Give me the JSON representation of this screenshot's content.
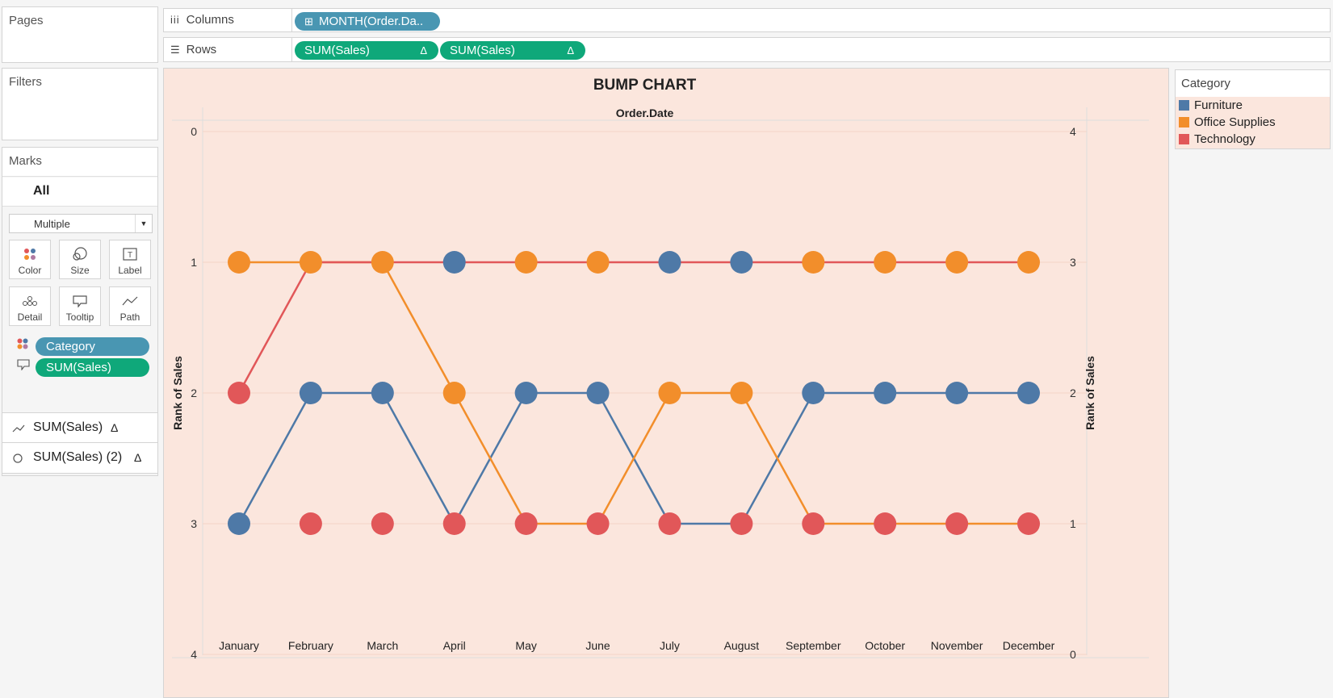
{
  "shelves": {
    "pages_label": "Pages",
    "filters_label": "Filters",
    "columns_label": "Columns",
    "rows_label": "Rows",
    "columns_pill": "MONTH(Order.Da..",
    "rows_pills": [
      "SUM(Sales)",
      "SUM(Sales)"
    ],
    "delta_symbol": "Δ"
  },
  "marks": {
    "title": "Marks",
    "all_label": "All",
    "mark_type": "Multiple",
    "buttons": [
      {
        "label": "Color",
        "icon": "color-icon"
      },
      {
        "label": "Size",
        "icon": "size-icon"
      },
      {
        "label": "Label",
        "icon": "label-icon"
      },
      {
        "label": "Detail",
        "icon": "detail-icon"
      },
      {
        "label": "Tooltip",
        "icon": "tooltip-icon"
      },
      {
        "label": "Path",
        "icon": "path-icon"
      }
    ],
    "fields": [
      {
        "label": "Category",
        "icon": "color-icon",
        "color": "#4996b2"
      },
      {
        "label": "SUM(Sales)",
        "icon": "tooltip-icon",
        "color": "#0fa87a"
      }
    ],
    "cards": [
      {
        "label": "SUM(Sales)",
        "delta": "Δ",
        "icon": "line-icon"
      },
      {
        "label": "SUM(Sales) (2)",
        "delta": "Δ",
        "icon": "circle-icon"
      }
    ]
  },
  "legend": {
    "title": "Category",
    "items": [
      {
        "label": "Furniture",
        "color": "#4e79a7"
      },
      {
        "label": "Office Supplies",
        "color": "#f28e2b"
      },
      {
        "label": "Technology",
        "color": "#e15759"
      }
    ]
  },
  "chart_data": {
    "type": "line",
    "title": "BUMP CHART",
    "column_header": "Order.Date",
    "ylabel": "Rank of Sales",
    "y2label": "Rank of Sales",
    "ylim": [
      4,
      0
    ],
    "y_ticks": [
      "0",
      "1",
      "2",
      "3",
      "4"
    ],
    "y2_ticks": [
      "4",
      "3",
      "2",
      "1",
      "0"
    ],
    "background": "#fbe6dd",
    "categories": [
      "January",
      "February",
      "March",
      "April",
      "May",
      "June",
      "July",
      "August",
      "September",
      "October",
      "November",
      "December"
    ],
    "series": [
      {
        "name": "Furniture",
        "color": "#4e79a7",
        "values": [
          3,
          2,
          2,
          3,
          2,
          2,
          3,
          3,
          2,
          2,
          2,
          2
        ]
      },
      {
        "name": "Office Supplies",
        "color": "#f28e2b",
        "values": [
          1,
          1,
          1,
          2,
          3,
          3,
          2,
          2,
          3,
          3,
          3,
          3
        ]
      },
      {
        "name": "Technology",
        "color": "#e15759",
        "values": [
          2,
          1,
          1,
          1,
          1,
          1,
          1,
          1,
          1,
          1,
          1,
          1
        ]
      }
    ],
    "markers": [
      {
        "name": "Furniture",
        "color": "#4e79a7",
        "values": [
          3,
          2,
          2,
          1,
          2,
          2,
          1,
          1,
          2,
          2,
          2,
          2
        ]
      },
      {
        "name": "Office Supplies",
        "color": "#f28e2b",
        "values": [
          1,
          1,
          1,
          2,
          1,
          1,
          2,
          2,
          1,
          1,
          1,
          1
        ]
      },
      {
        "name": "Technology",
        "color": "#e15759",
        "values": [
          2,
          3,
          3,
          3,
          3,
          3,
          3,
          3,
          3,
          3,
          3,
          3
        ]
      }
    ]
  }
}
